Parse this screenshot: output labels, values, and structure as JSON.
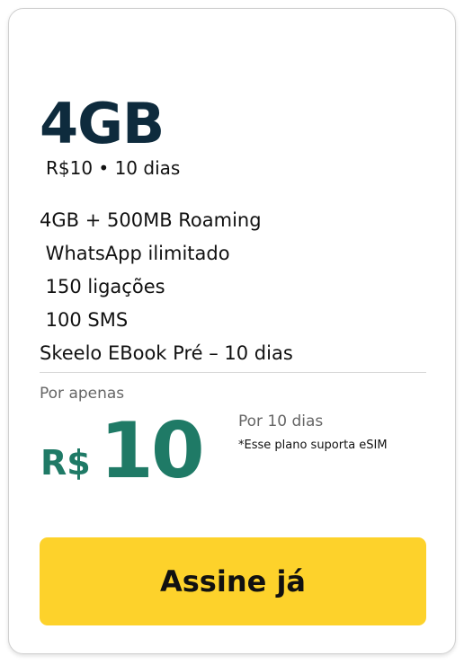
{
  "plan": {
    "title": "4GB",
    "subtitle": "R$10 • 10 dias",
    "features": [
      "4GB + 500MB Roaming",
      " WhatsApp ilimitado",
      " 150 ligações",
      " 100 SMS",
      "Skeelo EBook Pré – 10 dias"
    ]
  },
  "price": {
    "prefix": "Por apenas",
    "currency": "R$",
    "amount": "10",
    "period": "Por 10 dias",
    "note": "*Esse plano suporta eSIM"
  },
  "cta": {
    "label": "Assine já"
  },
  "colors": {
    "title": "#0e2b3d",
    "price": "#1f7a66",
    "cta_background": "#fdd22b",
    "muted_text": "#666666"
  }
}
